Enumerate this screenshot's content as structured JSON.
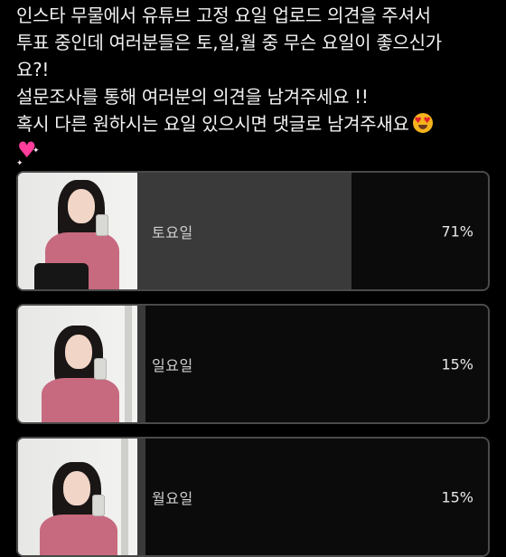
{
  "post": {
    "line1": "인스타 무물에서 유튜브 고정 요일 업로드 의견을 주셔서",
    "line2": "투표 중인데 여러분들은 토,일,월 중 무슨 요일이 좋으신가",
    "line3": "요?!",
    "line4": "설문조사를 통해 여러분의 의견을 남겨주세요 !!",
    "line5": "혹시 다른 원하시는 요일 있으시면 댓글로 남겨주새요",
    "emoji1": "smiling-face-with-heart-eyes",
    "emoji2": "sparkling-heart"
  },
  "poll": {
    "options": [
      {
        "label": "토요일",
        "percent_text": "71%",
        "percent": 71
      },
      {
        "label": "일요일",
        "percent_text": "15%",
        "percent": 15
      },
      {
        "label": "월요일",
        "percent_text": "15%",
        "percent": 15
      }
    ]
  },
  "colors": {
    "background": "#000000",
    "bar_fill": "#3a3a3a",
    "border": "#4a4a4a"
  }
}
